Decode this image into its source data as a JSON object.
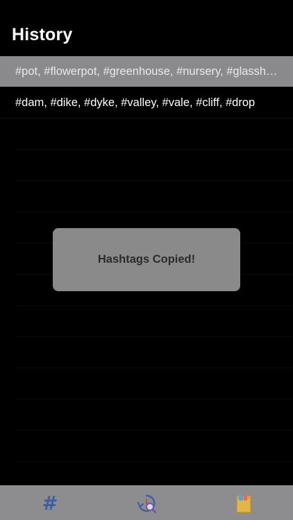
{
  "header": {
    "title": "History"
  },
  "history": {
    "items": [
      {
        "text": "#pot, #flowerpot, #greenhouse, #nursery, #glasshouse",
        "selected": true
      },
      {
        "text": "#dam, #dike, #dyke, #valley, #vale, #cliff, #drop",
        "selected": false
      }
    ]
  },
  "toast": {
    "message": "Hashtags Copied!"
  },
  "tabbar": {
    "tabs": [
      {
        "icon": "hashtag-icon",
        "glyph": "#"
      },
      {
        "icon": "search-history-icon"
      },
      {
        "icon": "collection-icon"
      }
    ]
  },
  "colors": {
    "background": "#000000",
    "selected_row": "#8a8a8c",
    "toast": "#8a8a8a",
    "tabbar": "#8d8d8f",
    "hashtag_accent": "#3d5fa3"
  }
}
